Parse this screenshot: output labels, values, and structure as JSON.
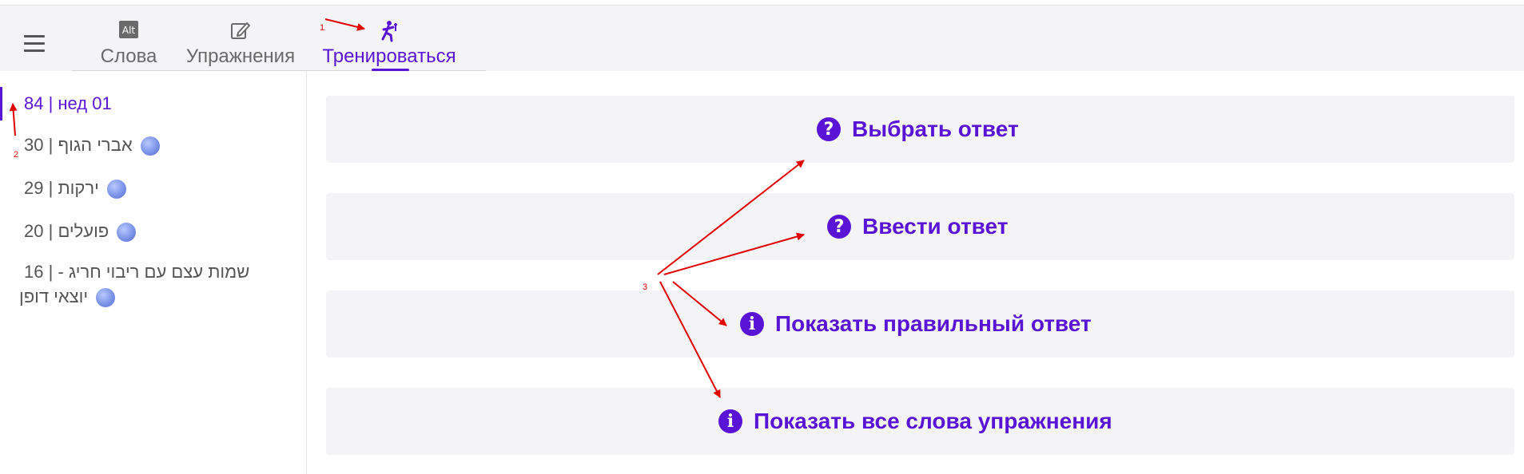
{
  "colors": {
    "accent": "#5a14d6",
    "annotation": "#e00000"
  },
  "header": {
    "menu_icon": "hamburger-icon",
    "tabs": [
      {
        "label": "Слова",
        "icon": "alt-icon",
        "active": false
      },
      {
        "label": "Упражнения",
        "icon": "edit-icon",
        "active": false
      },
      {
        "label": "Тренироваться",
        "icon": "exercise-icon",
        "active": true
      }
    ]
  },
  "sidebar": {
    "items": [
      {
        "text": "84 | нед 01",
        "active": true
      },
      {
        "count": "30",
        "name": "אברי הגוף",
        "icon": "globe-icon"
      },
      {
        "count": "29",
        "name": "ירקות",
        "icon": "globe-icon"
      },
      {
        "count": "20",
        "name": "פועלים",
        "icon": "globe-icon"
      },
      {
        "count": "16",
        "name_line1": "שמות עצם עם ריבוי חריג -",
        "name_line2": "יוצאי דופן",
        "icon": "globe-icon"
      }
    ]
  },
  "main": {
    "actions": [
      {
        "label": "Выбрать ответ",
        "icon": "question-circle-icon"
      },
      {
        "label": "Ввести ответ",
        "icon": "question-circle-icon"
      },
      {
        "label": "Показать правильный ответ",
        "icon": "info-circle-icon"
      },
      {
        "label": "Показать все слова упражнения",
        "icon": "info-circle-icon"
      }
    ]
  },
  "annotations": {
    "one": "1",
    "two": "2",
    "three": "3"
  },
  "glyphs": {
    "question": "?",
    "info": "i",
    "alt": "Alt"
  }
}
